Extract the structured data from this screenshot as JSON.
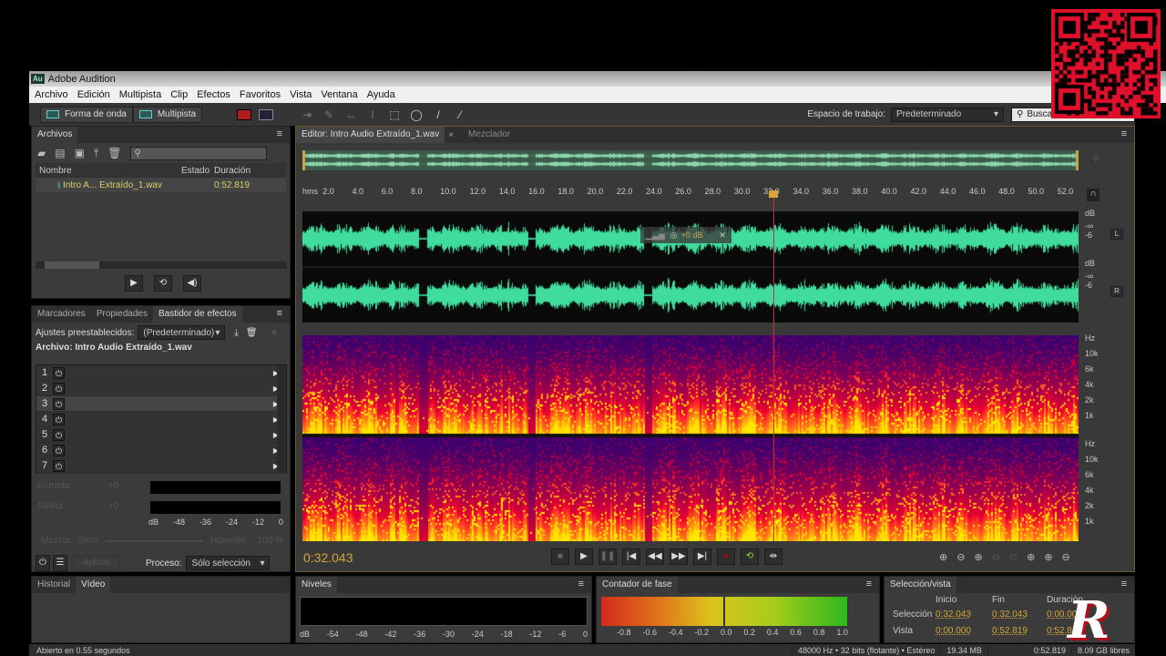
{
  "app": {
    "title": "Adobe Audition",
    "logo": "Au"
  },
  "menu": [
    "Archivo",
    "Edición",
    "Multipista",
    "Clip",
    "Efectos",
    "Favoritos",
    "Vista",
    "Ventana",
    "Ayuda"
  ],
  "toolbar": {
    "waveform": "Forma de onda",
    "multitrack": "Multipista",
    "workspace_label": "Espacio de trabajo:",
    "workspace_value": "Predeterminado",
    "search_placeholder": "Buscar en la Ayuda"
  },
  "files": {
    "tab": "Archivos",
    "columns": [
      "Nombre",
      "Estado",
      "Duración"
    ],
    "items": [
      {
        "name": "Intro A... Extraído_1.wav",
        "status": "",
        "duration": "0:52.819"
      }
    ]
  },
  "effects": {
    "tabs": [
      "Marcadores",
      "Propiedades",
      "Bastidor de efectos"
    ],
    "preset_label": "Ajustes preestablecidos:",
    "preset_value": "(Predeterminado)",
    "file_label": "Archivo: Intro Audio Extraído_1.wav",
    "slots": [
      "1",
      "2",
      "3",
      "4",
      "5",
      "6",
      "7"
    ],
    "input_label": "Entrada:",
    "input_value": "+0",
    "output_label": "Salida:",
    "output_value": "+0",
    "meter_ticks": [
      "dB",
      "-48",
      "-36",
      "-24",
      "-12",
      "0"
    ],
    "mix_label": "Mezcla:",
    "dry": "Seco",
    "wet": "Húmedo",
    "mix_value": "100 %",
    "apply": "Aplicar",
    "process_label": "Proceso:",
    "process_value": "Sólo selección"
  },
  "history": {
    "tabs": [
      "Historial",
      "Vídeo"
    ]
  },
  "editor": {
    "tab": "Editor: Intro Audio Extraído_1.wav",
    "tab2": "Mezclador",
    "ruler": [
      "hms",
      "2.0",
      "4.0",
      "6.0",
      "8.0",
      "10.0",
      "12.0",
      "14.0",
      "16.0",
      "18.0",
      "20.0",
      "22.0",
      "24.0",
      "26.0",
      "28.0",
      "30.0",
      "32.0",
      "34.0",
      "36.0",
      "38.0",
      "40.0",
      "42.0",
      "44.0",
      "46.0",
      "48.0",
      "50.0",
      "52.0"
    ],
    "hud_gain": "+0 dB",
    "db_scale": {
      "unit": "dB",
      "inf": "-∞",
      "m6": "-6"
    },
    "channels": [
      "L",
      "R"
    ],
    "hz_scale": [
      "Hz",
      "10k",
      "6k",
      "4k",
      "2k",
      "1k"
    ],
    "time": "0:32.043",
    "playhead_fraction": 0.607
  },
  "levels": {
    "tab": "Niveles",
    "ticks": [
      "dB",
      "-54",
      "-48",
      "-42",
      "-36",
      "-30",
      "-24",
      "-18",
      "-12",
      "-6",
      "0"
    ]
  },
  "phase": {
    "tab": "Contador de fase",
    "ticks": [
      "-0.8",
      "-0.6",
      "-0.4",
      "-0.2",
      "0.0",
      "0.2",
      "0.4",
      "0.6",
      "0.8",
      "1.0"
    ]
  },
  "selection": {
    "tab": "Selección/vista",
    "cols": [
      "Inicio",
      "Fin",
      "Duración"
    ],
    "rows": [
      {
        "label": "Selección",
        "start": "0:32.043",
        "end": "0:32.043",
        "dur": "0:00.000"
      },
      {
        "label": "Vista",
        "start": "0:00.000",
        "end": "0:52.819",
        "dur": "0:52.819"
      }
    ]
  },
  "status": {
    "left": "Abierto en 0.55 segundos",
    "format": "48000 Hz • 32 bits (flotante) • Estéreo",
    "size": "19.34 MB",
    "duration": "0:52.819",
    "free": "8.09 GB libres"
  },
  "watermark": "RFX",
  "colors": {
    "wave": "#3fdc9d",
    "accent": "#d6a53a",
    "playhead": "#c83232"
  }
}
